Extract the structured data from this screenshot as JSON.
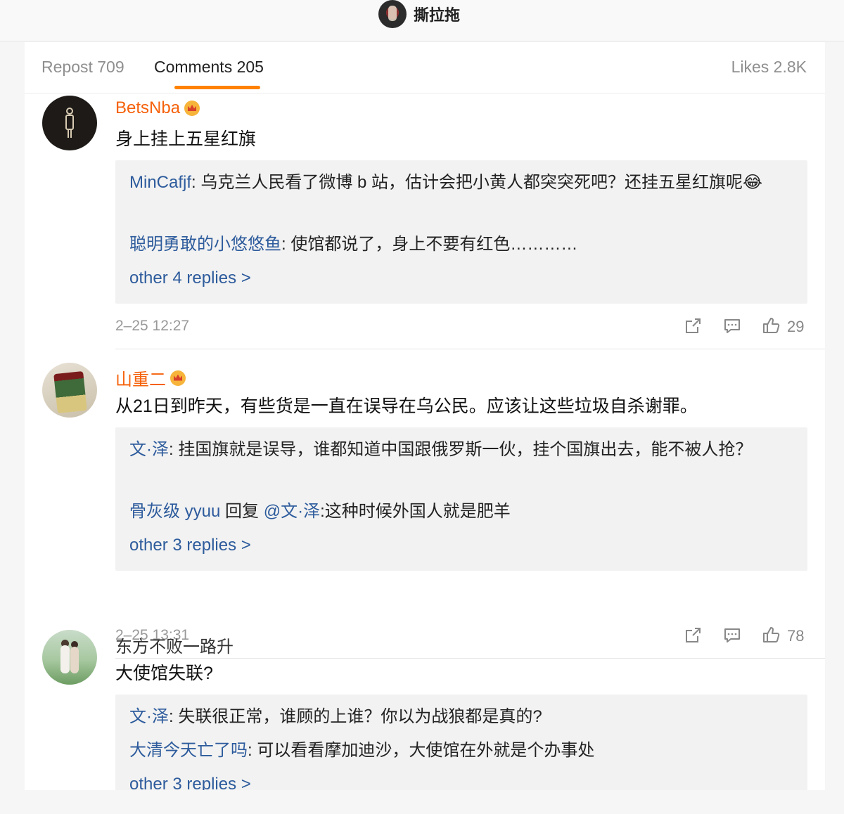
{
  "header": {
    "title": "撕拉拖"
  },
  "tabs": {
    "repost": "Repost 709",
    "comments": "Comments 205",
    "likes": "Likes 2.8K"
  },
  "colors": {
    "accent": "#ff8200",
    "vip_name": "#f5610a",
    "link": "#2d5b9c"
  },
  "comments": [
    {
      "user": "BetsNba",
      "vip": true,
      "text": "身上挂上五星红旗",
      "replies": [
        {
          "user": "MinCafjf",
          "text": ": 乌克兰人民看了微博 b 站，估计会把小黄人都突突死吧？还挂五星红旗呢😂"
        },
        {
          "user": "聪明勇敢的小悠悠鱼",
          "text": ": 使馆都说了，身上不要有红色…………"
        }
      ],
      "more": "other 4 replies >",
      "time": "2–25 12:27",
      "likes": "29"
    },
    {
      "user": "山重二",
      "vip": true,
      "text": "从21日到昨天，有些货是一直在误导在乌公民。应该让这些垃圾自杀谢罪。",
      "replies": [
        {
          "user": "文·泽",
          "text": ": 挂国旗就是误导，谁都知道中国跟俄罗斯一伙，挂个国旗出去，能不被人抢？"
        },
        {
          "user": "骨灰级 yyuu",
          "text_mid": " 回复 ",
          "mention": "@文·泽",
          "text": ":这种时候外国人就是肥羊"
        }
      ],
      "more": "other 3 replies >",
      "time": "2–25 13:31",
      "likes": "78"
    },
    {
      "user": "东方不败一路升",
      "vip": false,
      "text": "大使馆失联?",
      "replies": [
        {
          "user": "文·泽",
          "text": ": 失联很正常，谁顾的上谁？你以为战狼都是真的?"
        },
        {
          "user": "大清今天亡了吗",
          "text": ": 可以看看摩加迪沙，大使馆在外就是个办事处"
        }
      ],
      "more": "other 3 replies >"
    }
  ],
  "icons": [
    "share-icon",
    "comment-icon",
    "like-icon",
    "crown-badge-icon"
  ]
}
